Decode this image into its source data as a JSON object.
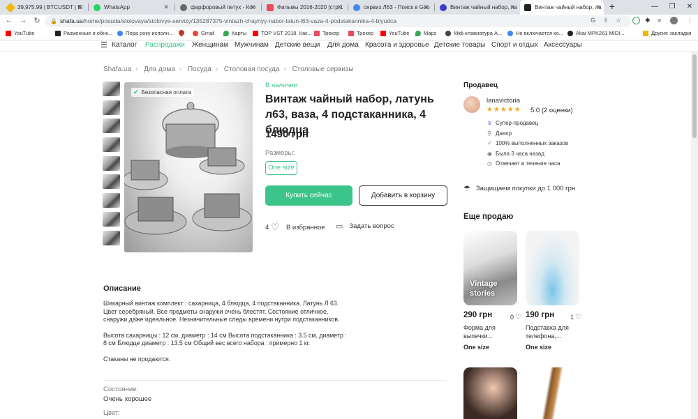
{
  "browser": {
    "tabs": [
      {
        "title": "39,975.99 | BTCUSDT | Bi",
        "icon_color": "#f0b90b"
      },
      {
        "title": "WhatsApp",
        "icon_color": "#25d366"
      },
      {
        "title": "фарфоровый петух - Кол",
        "icon_color": "#666666"
      },
      {
        "title": "Фильмы 2016-2020 [стр.1",
        "icon_color": "#e84a5f"
      },
      {
        "title": "сервиз Л63 - Поиск в Goo",
        "icon_color": "#4285f4"
      },
      {
        "title": "Винтаж чайный набор, ла",
        "icon_color": "#3b3bc4"
      },
      {
        "title": "Винтаж чайный набор, ла",
        "icon_color": "#222222"
      }
    ],
    "url_host": "shafa.ua",
    "url_path": "/home/posuda/stolovaya/stolovye-servizy/135287375-vintazh-chaynyy-nabor-latun-l63-vaza-4-podstakannika-4-blyudca",
    "bookmarks": [
      {
        "label": "YouTube",
        "icon_color": "#ff0000"
      },
      {
        "label": "Разменные и обнк...",
        "icon_color": "#222222"
      },
      {
        "label": "Пора року исполн...",
        "icon_color": "#4285f4"
      },
      {
        "label": "",
        "icon_color": "#c0392b"
      },
      {
        "label": "Gmail",
        "icon_color": "#ea4335"
      },
      {
        "label": "Карты",
        "icon_color": "#34a853"
      },
      {
        "label": "TOP VST 2018. Как...",
        "icon_color": "#ff0000"
      },
      {
        "label": "Трекер",
        "icon_color": "#e84a5f"
      },
      {
        "label": "Трекер",
        "icon_color": "#e84a5f"
      },
      {
        "label": "YouTube",
        "icon_color": "#ff0000"
      },
      {
        "label": "Maps",
        "icon_color": "#34a853"
      },
      {
        "label": "Midi-клавиатура A...",
        "icon_color": "#444444"
      },
      {
        "label": "Не включается ко...",
        "icon_color": "#4285f4"
      },
      {
        "label": "Akai MPK261 MIDI...",
        "icon_color": "#222222"
      },
      {
        "label": "Другие закладки",
        "icon_color": "#f4b400"
      }
    ]
  },
  "site": {
    "nav": {
      "catalog": "Каталог",
      "items": [
        "Распродажи",
        "Женщинам",
        "Мужчинам",
        "Детские вещи",
        "Для дома",
        "Красота и здоровье",
        "Детские товары",
        "Спорт и отдых",
        "Аксессуары"
      ]
    },
    "breadcrumb": [
      "Shafa.ua",
      "Для дома",
      "Посуда",
      "Столовая посуда",
      "Столовые сервизы"
    ],
    "gallery": {
      "safe_payment": "Безопасная оплата"
    },
    "product": {
      "availability": "В наличии",
      "title": "Винтаж чайный набор, латунь л63, ваза, 4 подстаканника, 4 блюдца",
      "price": "1490 грн",
      "sizes_label": "Размеры:",
      "size": "One size",
      "buy_label": "Купить сейчас",
      "cart_label": "Добавить в корзину",
      "favorites_count": "4",
      "favorites_label": "В избранное",
      "ask_label": "Задать вопрос"
    },
    "description": {
      "heading": "Описание",
      "p1": "Шикарный винтаж комплект : сахарница, 4 блюдца, 4 подстаканника. Латунь Л 63. Цвет серебряный. Все предметы снаружи очень блестят. Состояние отличное, снаружи даже идеальное. Незначительные следы времени нутри подстаканников.",
      "p2": "Высота сахарницы : 12 см, диаметр : 14 см Высота подстаканника : 3.5 см, диаметр : 8 см Блюдце диаметр : 13.5 см Общий вес всего набора : примерно 1 кг.",
      "p3": "Стаканы не продаются.",
      "condition_label": "Состояние:",
      "condition_value": "Очень хорошее",
      "color_label": "Цвет:"
    },
    "seller": {
      "heading": "Продавец",
      "name": "lanavictoria",
      "rating": "5.0 (2 оценки)",
      "attrs": [
        "Супер-продавец",
        "Днепр",
        "100% выполненных заказов",
        "Была 3 часа назад",
        "Отвечает в течение часа"
      ],
      "protection": "Защищаем покупки до 1 000 грн"
    },
    "more": {
      "heading": "Еще продаю",
      "cards": [
        {
          "overlay": "Vintage stories",
          "price": "290 грн",
          "likes": "0",
          "title": "Форма для выпечки...",
          "size": "One size"
        },
        {
          "overlay": "",
          "price": "190 грн",
          "likes": "1",
          "title": "Подставка для телефона,...",
          "size": "One size"
        }
      ]
    }
  }
}
